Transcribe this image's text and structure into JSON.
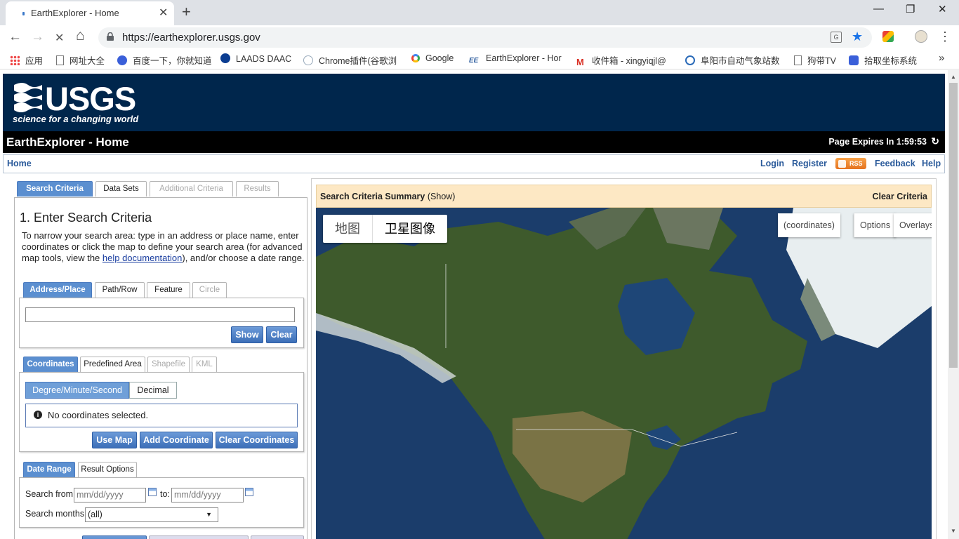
{
  "browser": {
    "tab_title": "EarthExplorer - Home",
    "tab_close": "✕",
    "new_tab": "+",
    "url": "https://earthexplorer.usgs.gov",
    "window_minimize": "—",
    "window_restore": "❐",
    "window_close": "✕",
    "back": "←",
    "forward": "→",
    "reload": "✕",
    "home": "⌂",
    "menu": "⋮",
    "bookmarks": [
      {
        "label": "应用",
        "icon": "apps-grid-icon"
      },
      {
        "label": "网址大全",
        "icon": "page-icon"
      },
      {
        "label": "百度一下，你就知道",
        "icon": "baidu-paw-icon"
      },
      {
        "label": "LAADS DAAC",
        "icon": "nasa-icon"
      },
      {
        "label": "Chrome插件(谷歌浏",
        "icon": "plugin-icon"
      },
      {
        "label": "Google",
        "icon": "google-icon"
      },
      {
        "label": "EarthExplorer - Hor",
        "icon": "ee-icon"
      },
      {
        "label": "收件箱 - xingyiqjl@",
        "icon": "gmail-icon"
      },
      {
        "label": "阜阳市自动气象站数",
        "icon": "globe-icon"
      },
      {
        "label": "狗带TV",
        "icon": "page-icon"
      },
      {
        "label": "拾取坐标系统",
        "icon": "baidu-paw-icon"
      }
    ],
    "bookmarks_more": "»"
  },
  "header": {
    "logo_text": "USGS",
    "logo_tagline": "science for a changing world",
    "page_title": "EarthExplorer - Home",
    "expires": "Page Expires In 1:59:53",
    "refresh": "↻"
  },
  "nav": {
    "home": "Home",
    "login": "Login",
    "register": "Register",
    "rss": "RSS",
    "feedback": "Feedback",
    "help": "Help"
  },
  "main_tabs": [
    "Search Criteria",
    "Data Sets",
    "Additional Criteria",
    "Results"
  ],
  "search": {
    "heading": "1. Enter Search Criteria",
    "desc_before": "To narrow your search area: type in an address or place name, enter coordinates or click the map to define your search area (for advanced map tools, view the ",
    "desc_link": "help documentation",
    "desc_after": "), and/or choose a date range.",
    "area_tabs": [
      "Address/Place",
      "Path/Row",
      "Feature",
      "Circle"
    ],
    "address_value": "",
    "show_btn": "Show",
    "clear_btn": "Clear",
    "coord_tabs": [
      "Coordinates",
      "Predefined Area",
      "Shapefile",
      "KML"
    ],
    "format_options": [
      "Degree/Minute/Second",
      "Decimal"
    ],
    "no_coords": "No coordinates selected.",
    "use_map": "Use Map",
    "add_coord": "Add Coordinate",
    "clear_coords": "Clear Coordinates",
    "date_tabs": [
      "Date Range",
      "Result Options"
    ],
    "search_from": "Search from:",
    "from_placeholder": "mm/dd/yyyy",
    "to": "to:",
    "to_placeholder": "mm/dd/yyyy",
    "search_months": "Search months:",
    "months_value": "(all)"
  },
  "map": {
    "summary_title": "Search Criteria Summary",
    "summary_show": "(Show)",
    "clear_criteria": "Clear Criteria",
    "map_type": [
      "地图",
      "卫星图像"
    ],
    "controls": [
      "(coordinates)",
      "Options",
      "Overlays"
    ]
  }
}
